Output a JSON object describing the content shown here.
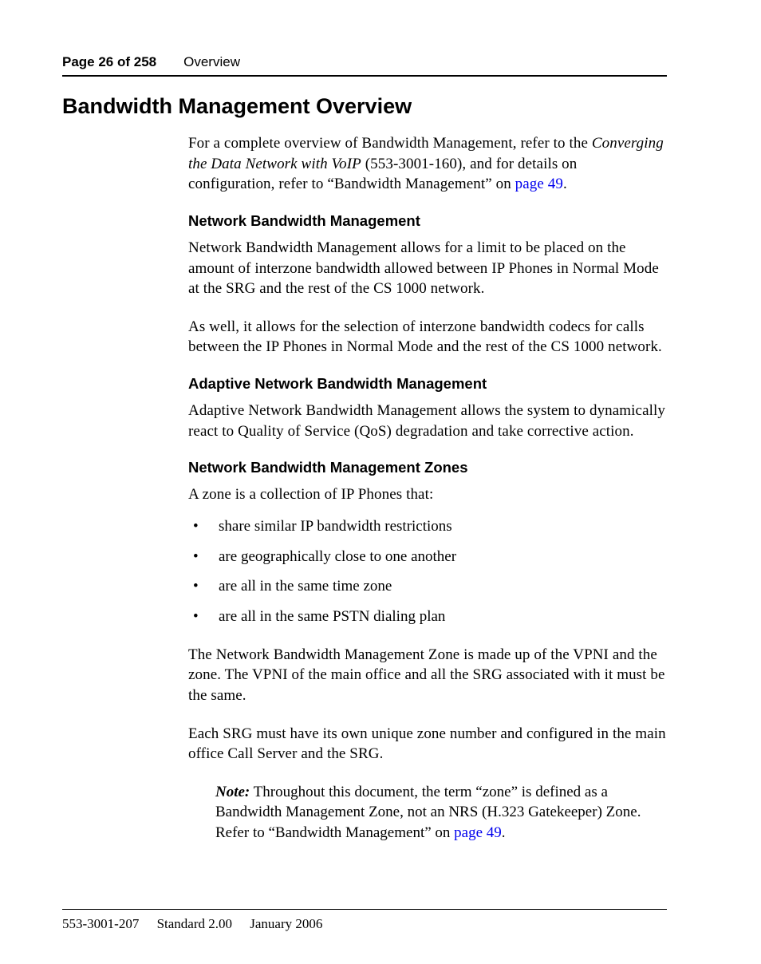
{
  "header": {
    "page_label": "Page 26 of 258",
    "section": "Overview"
  },
  "title": "Bandwidth Management Overview",
  "intro": {
    "pre": "For a complete overview of Bandwidth Management, refer to the ",
    "ital": "Converging the Data Network with VoIP",
    "mid": " (553-3001-160), and for details on configuration, refer to “Bandwidth Management” on ",
    "link": "page 49",
    "post": "."
  },
  "s1": {
    "heading": "Network Bandwidth Management",
    "p1": "Network Bandwidth Management allows for a limit to be placed on the amount of interzone bandwidth allowed between IP Phones in Normal Mode at the SRG and the rest of the CS 1000 network.",
    "p2": "As well, it allows for the selection of interzone bandwidth codecs for calls between the IP Phones in Normal Mode and the rest of the CS 1000 network."
  },
  "s2": {
    "heading": "Adaptive Network Bandwidth Management",
    "p1": "Adaptive Network Bandwidth Management allows the system to dynamically react to Quality of Service (QoS) degradation and take corrective action."
  },
  "s3": {
    "heading": "Network Bandwidth Management Zones",
    "lead": "A zone is a collection of IP Phones that:",
    "bullets": [
      "share similar IP bandwidth restrictions",
      "are geographically close to one another",
      "are all in the same time zone",
      "are all in the same PSTN dialing plan"
    ],
    "p2": "The Network Bandwidth Management Zone is made up of the VPNI and the zone. The VPNI of the main office and all the SRG associated with it must be the same.",
    "p3": "Each SRG must have its own unique zone number and configured in the main office Call Server and the SRG.",
    "note": {
      "label": "Note:",
      "pre": "  Throughout this document, the term “zone” is defined as a Bandwidth Management Zone, not an NRS (H.323 Gatekeeper) Zone. Refer to “Bandwidth Management” on ",
      "link": "page 49",
      "post": "."
    }
  },
  "footer": {
    "docnum": "553-3001-207",
    "std": "Standard 2.00",
    "date": "January 2006"
  }
}
